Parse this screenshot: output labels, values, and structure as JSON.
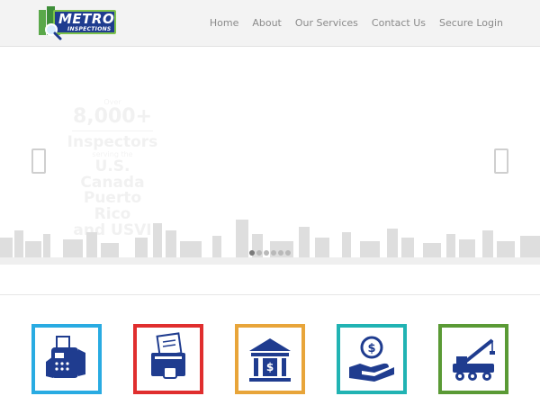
{
  "brand": {
    "name": "METRO",
    "tagline": "INSPECTIONS"
  },
  "nav": {
    "items": [
      {
        "label": "Home"
      },
      {
        "label": "About"
      },
      {
        "label": "Our Services"
      },
      {
        "label": "Contact Us"
      },
      {
        "label": "Secure Login"
      }
    ]
  },
  "hero": {
    "line1": "Over",
    "line2": "8,000+",
    "line3": "Inspectors",
    "line4": "serving the",
    "line5": "U.S.",
    "line6": "Canada",
    "line7": "Puerto Rico",
    "line8": "and USVI",
    "slides": 6,
    "active_slide": 0
  },
  "tiles": [
    {
      "icon": "fax-machine-icon",
      "color": "#29abe2"
    },
    {
      "icon": "secure-document-icon",
      "color": "#e02e2e"
    },
    {
      "icon": "bank-icon",
      "color": "#e8a53a"
    },
    {
      "icon": "money-hand-icon",
      "color": "#21b3b3"
    },
    {
      "icon": "crane-truck-icon",
      "color": "#5a9a35"
    }
  ]
}
